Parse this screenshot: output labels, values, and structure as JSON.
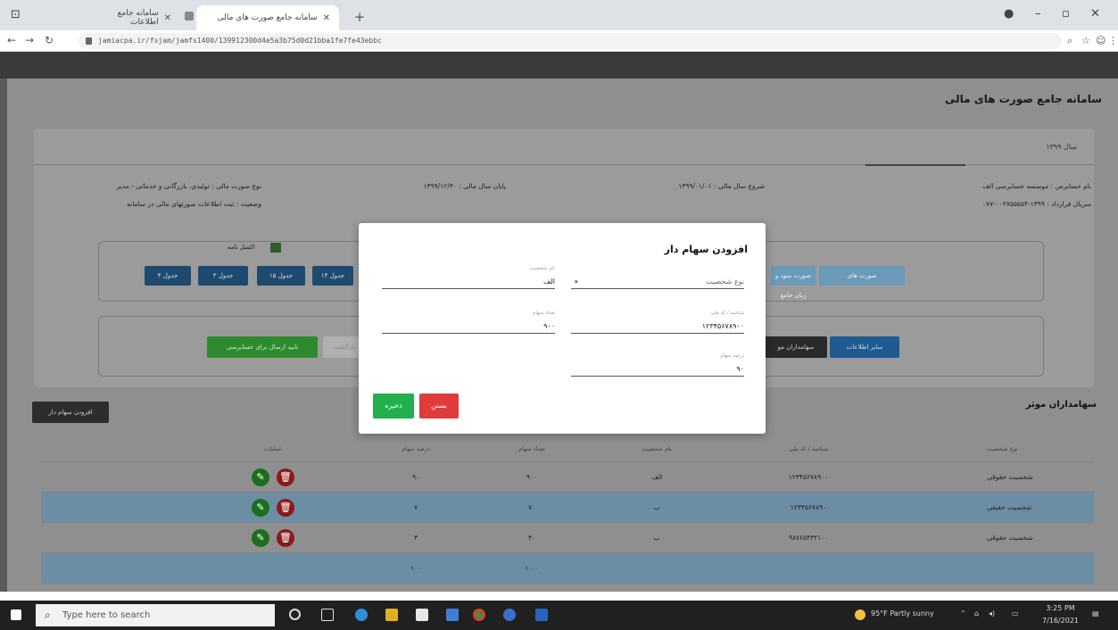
{
  "browser": {
    "tabs": [
      {
        "label": "سامانه جامع اطلاعات",
        "active": false
      },
      {
        "label": "سامانه جامع صورت های مالی",
        "active": true
      }
    ],
    "url": "jamiacpa.ir/fsjam/jamfs1400/139912300d4e5a3b75d0d21bba1fe7fe43ebbc"
  },
  "app": {
    "title": "سامانه جامع صورت های مالی",
    "year_tab": "سال ۱۳۹۹",
    "info": {
      "auditor": "نام حسابرس : موسسه حسابرسی الف",
      "contract_serial": "سریال قرارداد : ۱۳۹۹-۰۰۲۷۵۵۵۵۴-۰۷۷",
      "fiscal_start": "شروع سال مالی : ۱۳۹۹/۰۱/۰۱",
      "fiscal_end": "پایان سال مالی : ۱۳۹۹/۱۲/۳۰",
      "report_type": "نوع صورت مالی : تولیدی، بازرگانی و خدماتی - مدیر",
      "status": "وضعیت : ثبت اطلاعات صورتهای مالی در سامانه"
    },
    "excel_label": "اکسل نامه",
    "table_buttons": [
      "جدول ۴",
      "جدول ۳",
      "جدول ۱۵",
      "جدول ۱۴",
      "جدول ۱۳"
    ],
    "right_buttons": [
      "صورت های",
      "صورت سود و زیان جامع"
    ],
    "action_buttons": {
      "send_to_auditor": "تایید ارسال برای حسابرسی",
      "stub_grey": "بازگشت",
      "shareholders": "سهامداران مو",
      "other_info": "سایر اطلاعات"
    },
    "section_title": "سهامداران موثر",
    "add_shareholder_button": "افزودن سهام دار"
  },
  "table": {
    "headers": [
      "نوع شخصیت",
      "شناسه / کد ملی",
      "نام شخصیت",
      "تعداد سهام",
      "درصد سهام",
      "عملیات"
    ],
    "rows": [
      {
        "type": "شخصیت حقوقی",
        "nid": "۱۲۳۴۵۶۷۸۹۰۰",
        "name": "الف",
        "shares": "۹۰۰",
        "pct": "۹۰"
      },
      {
        "type": "شخصیت حقیقی",
        "nid": "۱۲۳۴۵۶۷۸۹۰",
        "name": "ب",
        "shares": "۷۰",
        "pct": "۷"
      },
      {
        "type": "شخصیت حقوقی",
        "nid": "۹۸۷۶۵۴۳۲۱۰۰",
        "name": "ب",
        "shares": "۳۰",
        "pct": "۳"
      }
    ],
    "footer": {
      "shares": "۱۰۰۰",
      "pct": "۱۰۰"
    }
  },
  "modal": {
    "title": "افزودن سهام دار",
    "fields": {
      "person_type": {
        "label": "نوع شخصیت",
        "value": ""
      },
      "name": {
        "label": "نام شخصیت",
        "value": "الف"
      },
      "national_id": {
        "label": "شناسه / کد ملی",
        "value": "۱۲۳۴۵۶۷۸۹۰۰"
      },
      "shares": {
        "label": "تعداد سهام",
        "value": "۹۰۰"
      },
      "percent": {
        "label": "درصد سهام",
        "value": "۹۰"
      }
    },
    "save_label": "ذخیره",
    "cancel_label": "بستن"
  },
  "taskbar": {
    "search_placeholder": "Type here to search",
    "weather": "95°F Partly sunny",
    "time": "3:25 PM",
    "date": "7/16/2021"
  }
}
